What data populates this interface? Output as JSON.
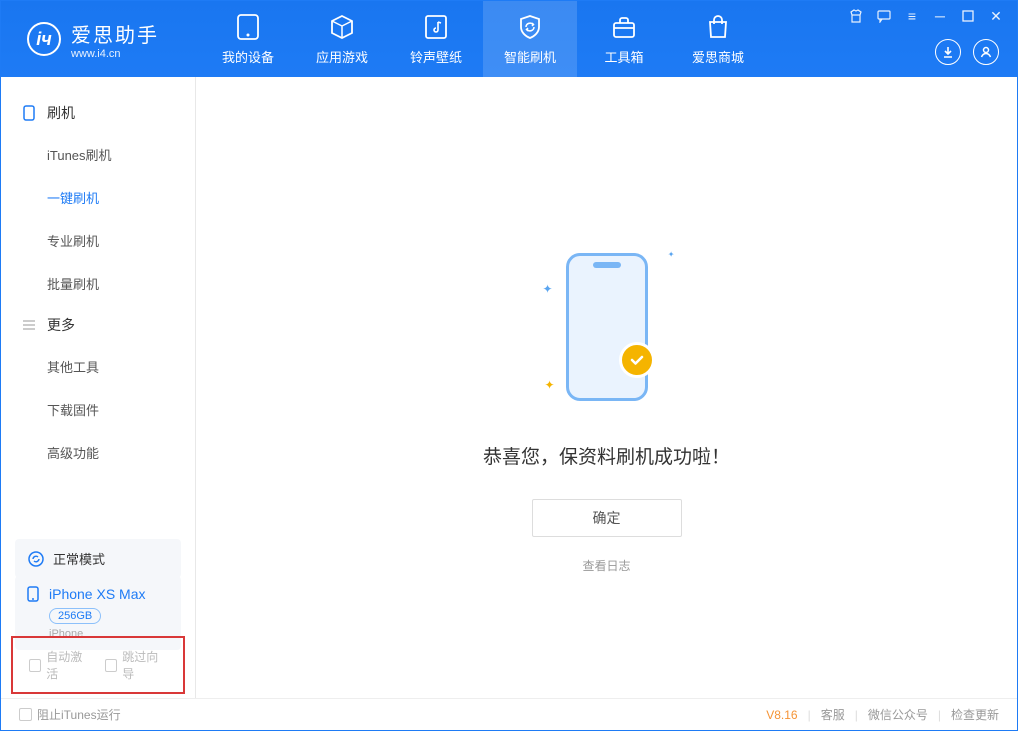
{
  "app": {
    "title": "爱思助手",
    "subtitle": "www.i4.cn"
  },
  "nav": {
    "tabs": [
      {
        "label": "我的设备",
        "active": false
      },
      {
        "label": "应用游戏",
        "active": false
      },
      {
        "label": "铃声壁纸",
        "active": false
      },
      {
        "label": "智能刷机",
        "active": true
      },
      {
        "label": "工具箱",
        "active": false
      },
      {
        "label": "爱思商城",
        "active": false
      }
    ]
  },
  "sidebar": {
    "group_flash": {
      "label": "刷机"
    },
    "items_flash": [
      {
        "label": "iTunes刷机",
        "active": false
      },
      {
        "label": "一键刷机",
        "active": true
      },
      {
        "label": "专业刷机",
        "active": false
      },
      {
        "label": "批量刷机",
        "active": false
      }
    ],
    "group_more": {
      "label": "更多"
    },
    "items_more": [
      {
        "label": "其他工具"
      },
      {
        "label": "下载固件"
      },
      {
        "label": "高级功能"
      }
    ],
    "device_mode": {
      "label": "正常模式"
    },
    "device": {
      "name": "iPhone XS Max",
      "capacity": "256GB",
      "type": "iPhone"
    },
    "check_auto_activate": "自动激活",
    "check_skip_guide": "跳过向导"
  },
  "main": {
    "success_message": "恭喜您，保资料刷机成功啦！",
    "ok_button": "确定",
    "view_log": "查看日志"
  },
  "footer": {
    "block_itunes": "阻止iTunes运行",
    "version": "V8.16",
    "link_service": "客服",
    "link_wechat": "微信公众号",
    "link_update": "检查更新"
  }
}
